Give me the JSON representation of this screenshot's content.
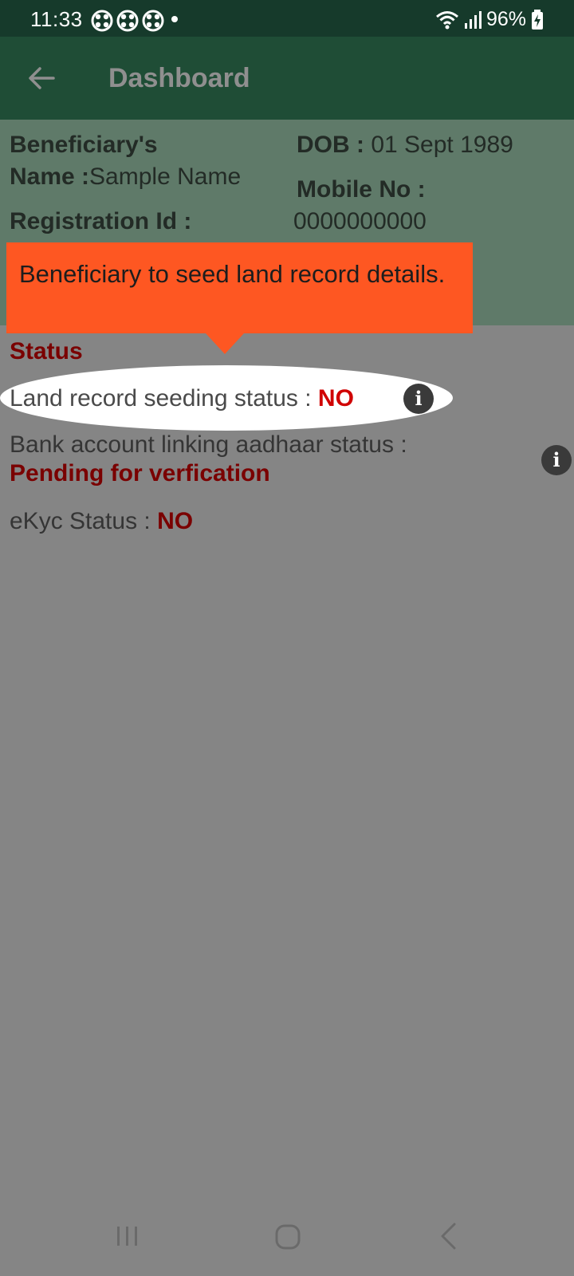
{
  "status_bar": {
    "time": "11:33",
    "battery": "96%",
    "notification_icons": [
      "ring-icon",
      "ring-icon",
      "ring-icon"
    ],
    "status_icons": [
      "wifi-icon",
      "signal-icon",
      "battery-charging-icon"
    ]
  },
  "app_bar": {
    "title": "Dashboard",
    "back_icon": "arrow-left-icon"
  },
  "info": {
    "beneficiary_label_line1": "Beneficiary's",
    "name_label": "Name :",
    "name_value": "Sample Name",
    "registration_label": "Registration Id :",
    "dob_label": "DOB :",
    "dob_value": " 01 Sept 1989",
    "mobile_label": "Mobile No :",
    "mobile_value": "0000000000"
  },
  "tooltip": {
    "text": "Beneficiary to seed land record details."
  },
  "status": {
    "heading": "Status",
    "land_label": "Land record seeding status : ",
    "land_value": "NO",
    "bank_label": "Bank account linking aadhaar status :",
    "bank_value": "Pending for verfication",
    "ekyc_label": "eKyc Status : ",
    "ekyc_value": "NO",
    "info_icon_glyph": "i"
  },
  "colors": {
    "status_bar_bg": "#163a2b",
    "app_bar_bg": "#1f4d36",
    "tooltip_bg": "#fe5722",
    "status_red": "#7a0000",
    "no_red": "#d00000",
    "overlay": "#858585"
  },
  "nav_bar": {
    "icons": [
      "recents-icon",
      "home-icon",
      "back-icon"
    ]
  }
}
